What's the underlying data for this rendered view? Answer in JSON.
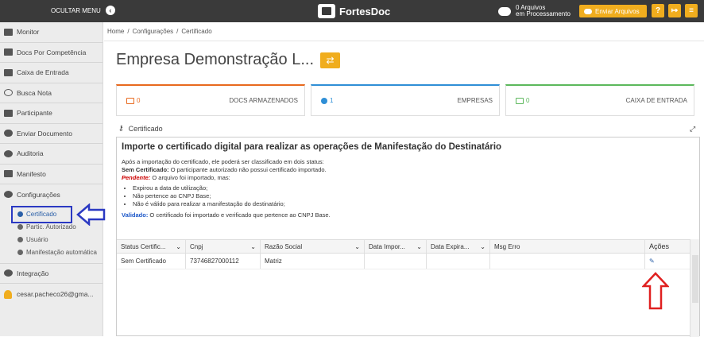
{
  "header": {
    "hide_menu": "OCULTAR MENU",
    "app_name": "FortesDoc",
    "processing_line1": "0 Arquivos",
    "processing_line2": "em Processamento",
    "send_button": "Enviar Arquivos"
  },
  "sidebar": {
    "items": [
      {
        "label": "Monitor",
        "icon": "monitor-icon"
      },
      {
        "label": "Docs Por Competência",
        "icon": "bar-chart-icon"
      },
      {
        "label": "Caixa de Entrada",
        "icon": "inbox-icon"
      },
      {
        "label": "Busca Nota",
        "icon": "search-icon"
      },
      {
        "label": "Participante",
        "icon": "building-icon"
      },
      {
        "label": "Enviar Documento",
        "icon": "cloud-upload-icon"
      },
      {
        "label": "Auditoria",
        "icon": "crosshair-icon"
      },
      {
        "label": "Manifesto",
        "icon": "download-icon"
      },
      {
        "label": "Configurações",
        "icon": "gears-icon"
      }
    ],
    "sub_items": [
      {
        "label": "Certificado",
        "icon": "key-icon"
      },
      {
        "label": "Partic. Autorizado",
        "icon": "users-icon"
      },
      {
        "label": "Usuário",
        "icon": "user-icon"
      },
      {
        "label": "Manifestação automática",
        "icon": "clock-icon"
      }
    ],
    "integration": "Integração",
    "user_email": "cesar.pacheco26@gma..."
  },
  "breadcrumb": [
    "Home",
    "Configurações",
    "Certificado"
  ],
  "page_title": "Empresa Demonstração L...",
  "stats": [
    {
      "value": "0",
      "label": "DOCS ARMAZENADOS",
      "color": "#e8691e"
    },
    {
      "value": "1",
      "label": "EMPRESAS",
      "color": "#2f8fd6"
    },
    {
      "value": "0",
      "label": "CAIXA DE ENTRADA",
      "color": "#5cb85c"
    }
  ],
  "panel": {
    "header": "Certificado",
    "heading": "Importe o certificado digital para realizar as operações de Manifestação do Destinatário",
    "intro": "Após a importação do certificado, ele poderá ser classificado em dois status:",
    "sem_cert_label": "Sem Certificado:",
    "sem_cert_text": " O participante autorizado não possui certificado importado.",
    "pendente_label": "Pendente:",
    "pendente_text": " O arquivo foi importado, mas:",
    "bullets": [
      "Expirou a data de utilização;",
      "Não pertence ao CNPJ Base;",
      "Não é válido para realizar a manifestação do destinatário;"
    ],
    "validado_label": "Validado:",
    "validado_text": " O certificado foi importado e verificado que pertence ao CNPJ Base."
  },
  "table": {
    "columns": [
      "Status Certific...",
      "Cnpj",
      "Razão Social",
      "Data Impor...",
      "Data Expira...",
      "Msg Erro",
      "Ações"
    ],
    "rows": [
      [
        "Sem Certificado",
        "73746827000112",
        "Matriz",
        "",
        "",
        "",
        ""
      ]
    ]
  }
}
